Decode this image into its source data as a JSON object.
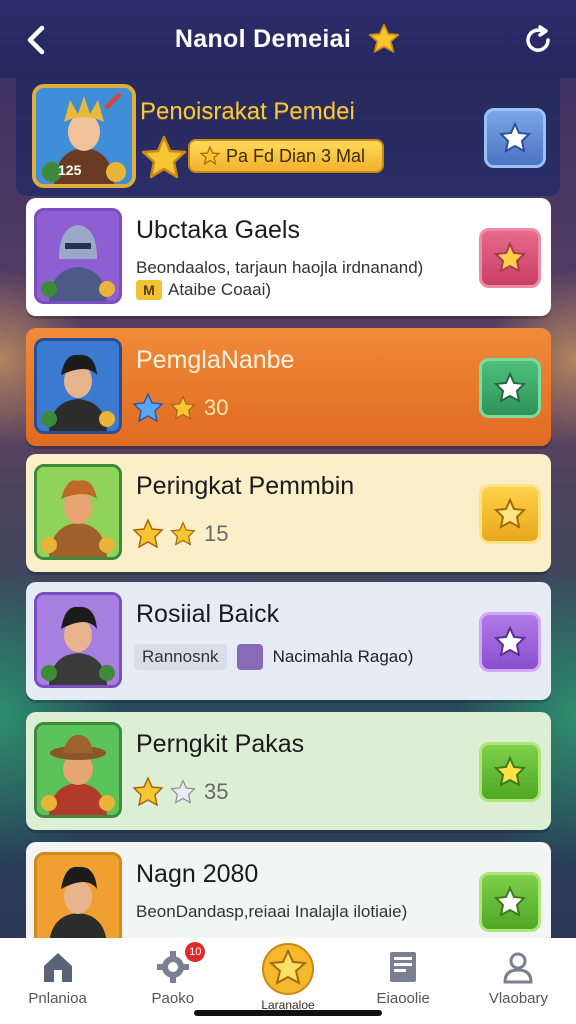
{
  "colors": {
    "topbar": "#2c2d6b",
    "gold": "#f5c842",
    "orange_card": "#e06b22",
    "green_button": "#4aa86b"
  },
  "topbar": {
    "title": "Nanol Demeiai",
    "back_icon": "chevron-left-icon",
    "refresh_icon": "refresh-icon"
  },
  "header": {
    "title": "Penoisrakat Pemdei",
    "badge_number": "125",
    "pill_text": "Pa Fd Dian 3 Mal"
  },
  "cards": [
    {
      "name": "Ubctaka Gaels",
      "sub": "Beondaalos, tarjaun haojla irdnanand)",
      "sub2_badge": "M",
      "sub2": "Ataibe Coaai)"
    },
    {
      "name": "PemglaNanbe",
      "rating": "30"
    },
    {
      "name": "Peringkat Pemmbin",
      "rating": "15"
    },
    {
      "name": "Rosiial Baick",
      "tag": "Rannosnk",
      "tag2": "Nacimahla Ragao)"
    },
    {
      "name": "Perngkit Pakas",
      "rating": "35"
    },
    {
      "name": "Nagn 2080",
      "sub": "BeonDandasp,reiaai Inalajla ilotiaie)"
    }
  ],
  "bottom_nav": [
    {
      "label": "Pnlanioa",
      "icon": "home-icon"
    },
    {
      "label": "Paoko",
      "icon": "gear-icon",
      "badge": "10"
    },
    {
      "label": "Laranaloe",
      "icon": "star-icon"
    },
    {
      "label": "Eiaoolie",
      "icon": "document-icon"
    },
    {
      "label": "Vlaobary",
      "icon": "user-icon"
    }
  ]
}
